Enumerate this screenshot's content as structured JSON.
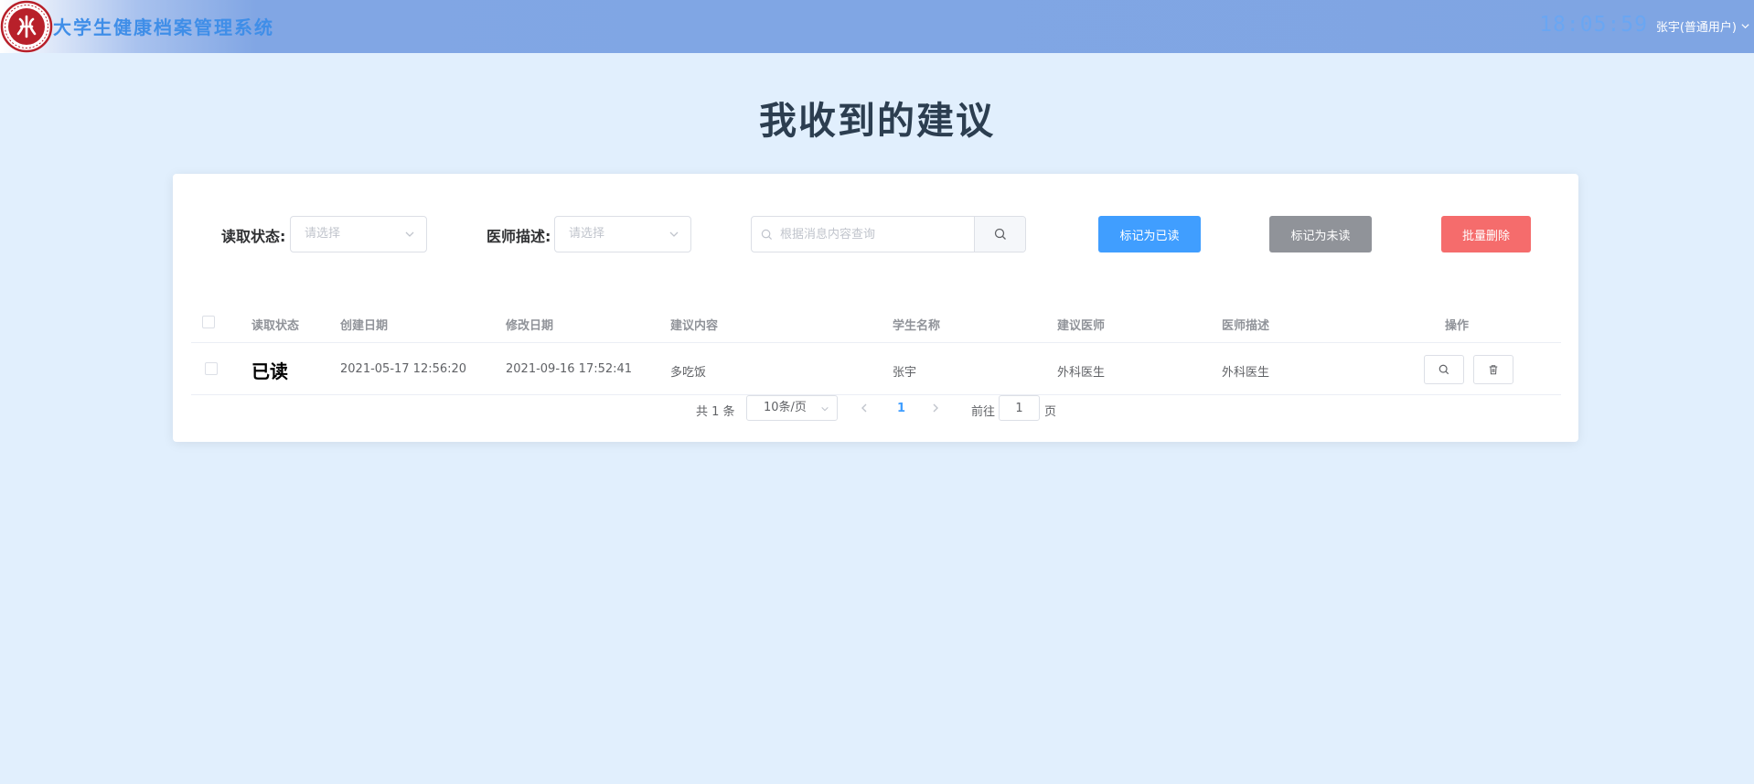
{
  "header": {
    "app_title": "大学生健康档案管理系统",
    "clock": "18:05:59",
    "user_label": "张宇(普通用户)"
  },
  "page": {
    "title": "我收到的建议"
  },
  "filters": {
    "read_status_label": "读取状态:",
    "read_status_placeholder": "请选择",
    "doctor_desc_label": "医师描述:",
    "doctor_desc_placeholder": "请选择",
    "search_placeholder": "根据消息内容查询"
  },
  "actions": {
    "mark_read": "标记为已读",
    "mark_unread": "标记为未读",
    "batch_delete": "批量删除"
  },
  "table": {
    "headers": {
      "read_status": "读取状态",
      "created": "创建日期",
      "modified": "修改日期",
      "content": "建议内容",
      "student": "学生名称",
      "doctor": "建议医师",
      "doctor_desc": "医师描述",
      "ops": "操作"
    },
    "rows": [
      {
        "read_status": "已读",
        "created": "2021-05-17 12:56:20",
        "modified": "2021-09-16 17:52:41",
        "content": "多吃饭",
        "student": "张宇",
        "doctor": "外科医生",
        "doctor_desc": "外科医生"
      }
    ]
  },
  "pagination": {
    "total": "共 1 条",
    "page_size": "10条/页",
    "current_page": "1",
    "goto_label": "前往",
    "goto_value": "1",
    "page_suffix": "页"
  },
  "colors": {
    "header_bg": "#7fa5e3",
    "page_bg": "#e1effd",
    "primary": "#409eff",
    "info": "#909399",
    "danger": "#f56c6c"
  }
}
